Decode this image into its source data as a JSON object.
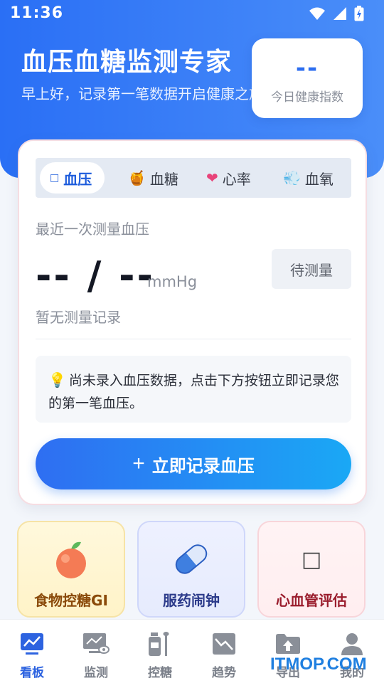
{
  "status_bar": {
    "time": "11:36"
  },
  "header": {
    "title": "血压血糖监测专家",
    "greeting": "早上好，记录第一笔数据开启健康之旅",
    "health_index": {
      "value": "--",
      "label": "今日健康指数"
    }
  },
  "tabs": [
    {
      "label": "血压",
      "icon": "□",
      "active": true
    },
    {
      "label": "血糖",
      "icon": "🍯",
      "active": false
    },
    {
      "label": "心率",
      "icon": "❤",
      "active": false
    },
    {
      "label": "血氧",
      "icon": "💨",
      "active": false
    }
  ],
  "measurement": {
    "section_label": "最近一次测量血压",
    "value": "-- / --",
    "unit": "mmHg",
    "status_button": "待测量",
    "no_record": "暂无测量记录"
  },
  "tip": {
    "icon": "💡",
    "text": "尚未录入血压数据，点击下方按钮立即记录您的第一笔血压。"
  },
  "record_button": {
    "icon": "+",
    "label": "立即记录血压"
  },
  "features": [
    {
      "label": "食物控糖GI",
      "icon": "apple-icon"
    },
    {
      "label": "服药闹钟",
      "icon": "pill-icon"
    },
    {
      "label": "心血管评估",
      "icon": "□"
    }
  ],
  "bottom_nav": [
    {
      "label": "看板",
      "icon": "dashboard-icon",
      "active": true
    },
    {
      "label": "监测",
      "icon": "monitor-icon",
      "active": false
    },
    {
      "label": "控糖",
      "icon": "sugar-icon",
      "active": false
    },
    {
      "label": "趋势",
      "icon": "trend-icon",
      "active": false
    },
    {
      "label": "导出",
      "icon": "export-icon",
      "active": false
    },
    {
      "label": "我的",
      "icon": "user-icon",
      "active": false
    }
  ],
  "watermark": "ITMOP.COM",
  "colors": {
    "primary": "#2d6ef0",
    "header_start": "#2a6ff5",
    "header_end": "#4a8ef9",
    "accent_gradient_end": "#1aa8f5"
  }
}
